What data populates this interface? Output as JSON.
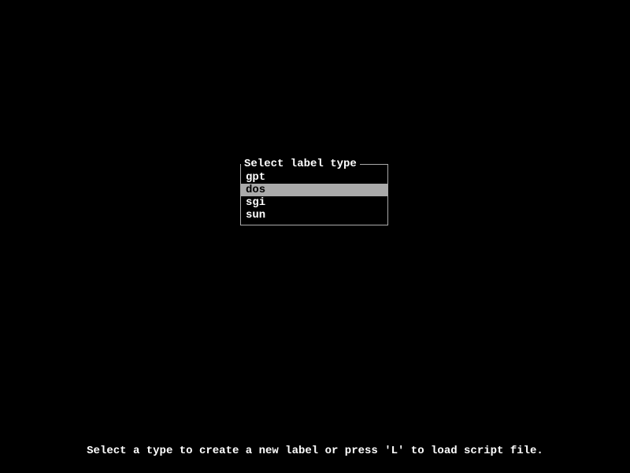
{
  "dialog": {
    "title": "Select label type",
    "items": [
      {
        "label": "gpt",
        "selected": false
      },
      {
        "label": "dos",
        "selected": true
      },
      {
        "label": "sgi",
        "selected": false
      },
      {
        "label": "sun",
        "selected": false
      }
    ]
  },
  "status": {
    "message": "Select a type to create a new label or press 'L' to load script file."
  }
}
